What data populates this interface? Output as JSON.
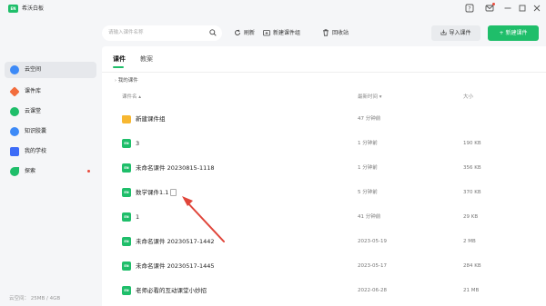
{
  "app": {
    "logo_text": "EN",
    "title": "希沃白板"
  },
  "window": {
    "icons": [
      "help-icon",
      "mail-icon",
      "minimize-icon",
      "maximize-icon",
      "close-icon"
    ]
  },
  "sidebar": {
    "items": [
      {
        "label": "云空间",
        "icon": "cloud-icon",
        "color": "#3d8af7",
        "active": true,
        "dot": false
      },
      {
        "label": "课件库",
        "icon": "gem-icon",
        "color": "#f26d3d",
        "active": false,
        "dot": false
      },
      {
        "label": "云课堂",
        "icon": "play-icon",
        "color": "#1fbe6a",
        "active": false,
        "dot": false
      },
      {
        "label": "知识胶囊",
        "icon": "capsule-icon",
        "color": "#3d8af7",
        "active": false,
        "dot": false
      },
      {
        "label": "我的学校",
        "icon": "school-icon",
        "color": "#3d6cf7",
        "active": false,
        "dot": false
      },
      {
        "label": "探索",
        "icon": "rocket-icon",
        "color": "#1fbe6a",
        "active": false,
        "dot": true
      }
    ],
    "storage": "云空间：  25MB / 4GB"
  },
  "toolbar": {
    "search_placeholder": "请输入课件名称",
    "refresh": "刷新",
    "new_group": "新建课件组",
    "recycle": "回收站",
    "import": "导入课件",
    "new_courseware": "+ 新建课件"
  },
  "tabs": [
    {
      "label": "课件",
      "active": true
    },
    {
      "label": "教案",
      "active": false
    }
  ],
  "breadcrumb": "我的课件",
  "columns": {
    "name": "课件名 ▴",
    "time": "最新时间 ▾",
    "size": "大小"
  },
  "rows": [
    {
      "type": "folder",
      "name": "新建课件组",
      "time": "47 分钟前",
      "size": ""
    },
    {
      "type": "file",
      "name": "3",
      "time": "1 分钟前",
      "size": "190 KB"
    },
    {
      "type": "file",
      "name": "未命名课件 20230815-1118",
      "time": "1 分钟前",
      "size": "356 KB"
    },
    {
      "type": "file",
      "name": "数学课件1.1",
      "time": "5 分钟前",
      "size": "370 KB",
      "extra_icon": "copy-icon"
    },
    {
      "type": "file",
      "name": "1",
      "time": "41 分钟前",
      "size": "29 KB"
    },
    {
      "type": "file",
      "name": "未命名课件 20230517-1442",
      "time": "2023-05-19",
      "size": "2 MB"
    },
    {
      "type": "file",
      "name": "未命名课件 20230517-1445",
      "time": "2023-05-17",
      "size": "284 KB"
    },
    {
      "type": "file",
      "name": "老师必看的互动课堂小妙招",
      "time": "2022-06-28",
      "size": "21 MB"
    }
  ],
  "colors": {
    "accent": "#1fbe6a",
    "annotation_arrow": "#e0453a",
    "folder": "#f7b731"
  }
}
